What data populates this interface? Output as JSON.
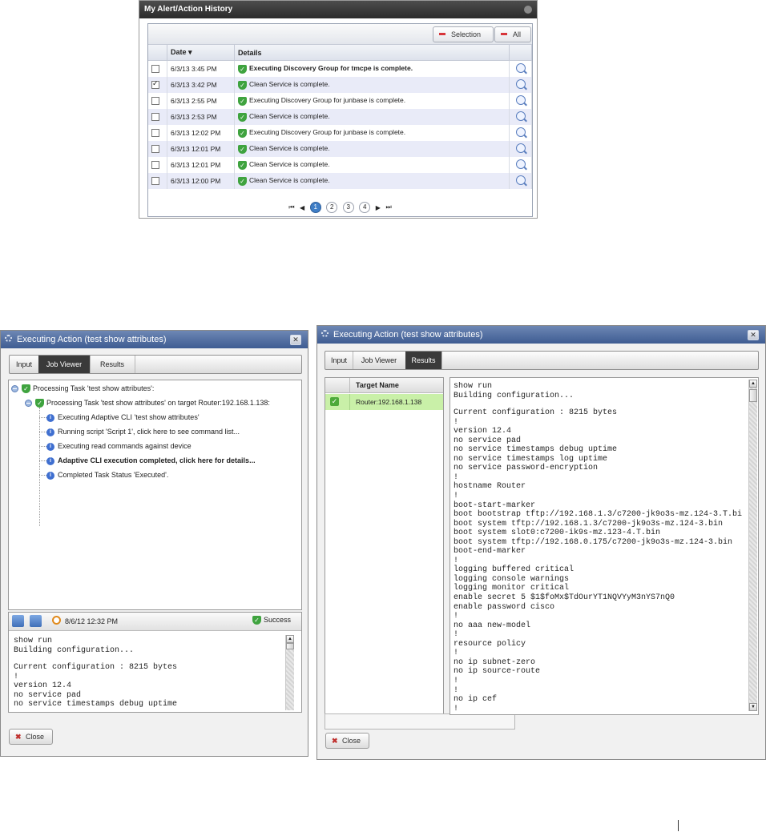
{
  "history": {
    "title": "My Alert/Action History",
    "buttons": {
      "selection": "Selection",
      "all": "All"
    },
    "columns": {
      "date": "Date",
      "details": "Details"
    },
    "rows": [
      {
        "date": "6/3/13 3:45 PM",
        "detail": "Executing Discovery Group for tmcpe is complete.",
        "checked": false,
        "bold": true
      },
      {
        "date": "6/3/13 3:42 PM",
        "detail": "Clean Service is complete.",
        "checked": true,
        "bold": false
      },
      {
        "date": "6/3/13 2:55 PM",
        "detail": "Executing Discovery Group for junbase is complete.",
        "checked": false,
        "bold": false
      },
      {
        "date": "6/3/13 2:53 PM",
        "detail": "Clean Service is complete.",
        "checked": false,
        "bold": false
      },
      {
        "date": "6/3/13 12:02 PM",
        "detail": "Executing Discovery Group for junbase is complete.",
        "checked": false,
        "bold": false
      },
      {
        "date": "6/3/13 12:01 PM",
        "detail": "Clean Service is complete.",
        "checked": false,
        "bold": false
      },
      {
        "date": "6/3/13 12:01 PM",
        "detail": "Clean Service is complete.",
        "checked": false,
        "bold": false
      },
      {
        "date": "6/3/13 12:00 PM",
        "detail": "Clean Service is complete.",
        "checked": false,
        "bold": false
      }
    ],
    "pager": {
      "pages": [
        "1",
        "2",
        "3",
        "4"
      ],
      "current": "1"
    }
  },
  "job_dialog": {
    "title": "Executing Action (test show attributes)",
    "tabs": [
      "Input",
      "Job Viewer",
      "Results"
    ],
    "active_tab": "Job Viewer",
    "tree": {
      "root": "Processing Task 'test show attributes':",
      "task": "Processing Task 'test show attributes' on target Router:192.168.1.138:",
      "steps": [
        {
          "text": "Executing Adaptive CLI 'test show attributes'",
          "bold": false
        },
        {
          "text": "Running script 'Script 1', click here to see command list...",
          "bold": false
        },
        {
          "text": "Executing read commands against device",
          "bold": false
        },
        {
          "text": "Adaptive CLI execution completed, click here for details...",
          "bold": true
        },
        {
          "text": "Completed Task Status 'Executed'.",
          "bold": false
        }
      ]
    },
    "detail_bar": {
      "timestamp": "8/6/12 12:32 PM",
      "status": "Success"
    },
    "output_lines": [
      "show run",
      "Building configuration...",
      "",
      "Current configuration : 8215 bytes",
      "!",
      "version 12.4",
      "no service pad",
      "no service timestamps debug uptime"
    ],
    "close_label": "Close"
  },
  "results_dialog": {
    "title": "Executing Action (test show attributes)",
    "tabs": [
      "Input",
      "Job Viewer",
      "Results"
    ],
    "active_tab": "Results",
    "target_header": "Target Name",
    "target": "Router:192.168.1.138",
    "output_lines": [
      "show run",
      "Building configuration...",
      "",
      "Current configuration : 8215 bytes",
      "!",
      "version 12.4",
      "no service pad",
      "no service timestamps debug uptime",
      "no service timestamps log uptime",
      "no service password-encryption",
      "!",
      "hostname Router",
      "!",
      "boot-start-marker",
      "boot bootstrap tftp://192.168.1.3/c7200-jk9o3s-mz.124-3.T.bi",
      "boot system tftp://192.168.1.3/c7200-jk9o3s-mz.124-3.bin",
      "boot system slot0:c7200-ik9s-mz.123-4.T.bin",
      "boot system tftp://192.168.0.175/c7200-jk9o3s-mz.124-3.bin",
      "boot-end-marker",
      "!",
      "logging buffered critical",
      "logging console warnings",
      "logging monitor critical",
      "enable secret 5 $1$foMx$TdOurYT1NQVYyM3nYS7nQ0",
      "enable password cisco",
      "!",
      "no aaa new-model",
      "!",
      "resource policy",
      "!",
      "no ip subnet-zero",
      "no ip source-route",
      "!",
      "!",
      "no ip cef",
      "!"
    ],
    "close_label": "Close"
  },
  "icons": {
    "success": "shield-check-icon",
    "info": "info-icon",
    "details": "magnifier-icon",
    "close": "x-icon"
  },
  "colors": {
    "title_blue": "#3e5c92",
    "success_green": "#3fa33f",
    "selected_row": "#c9f0a8",
    "tab_active": "#3a3a3a"
  }
}
